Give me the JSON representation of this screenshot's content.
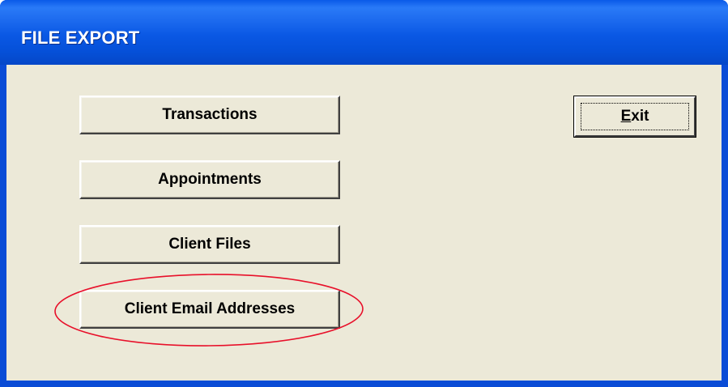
{
  "window": {
    "title": "FILE EXPORT"
  },
  "buttons": {
    "transactions": "Transactions",
    "appointments": "Appointments",
    "client_files": "Client Files",
    "client_email_addresses": "Client Email Addresses"
  },
  "exit_button": {
    "mnemonic": "E",
    "rest": "xit"
  },
  "colors": {
    "titlebar_blue": "#0a58e4",
    "dialog_face": "#ece9d8",
    "annotation_red": "#e8102a"
  }
}
